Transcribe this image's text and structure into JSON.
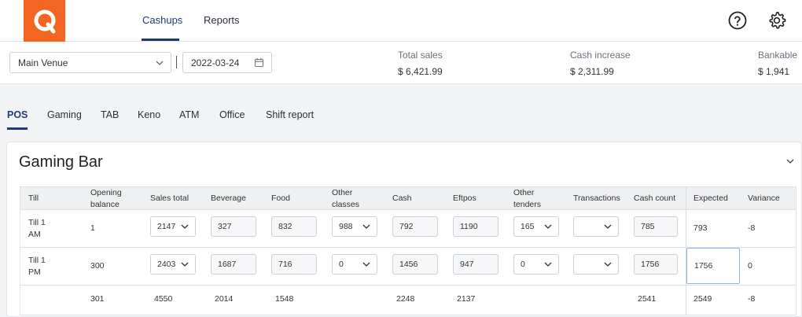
{
  "nav": {
    "logo_letter": "Q",
    "tabs": [
      "Cashups",
      "Reports"
    ]
  },
  "filters": {
    "venue": "Main Venue",
    "date": "2022-03-24"
  },
  "stats": [
    {
      "label": "Total sales",
      "value": "$ 6,421.99"
    },
    {
      "label": "Cash increase",
      "value": "$ 2,311.99"
    },
    {
      "label": "Bankable",
      "value": "$ 1,941"
    }
  ],
  "subtabs": [
    "POS",
    "Gaming",
    "TAB",
    "Keno",
    "ATM",
    "Office",
    "Shift report"
  ],
  "section": {
    "title": "Gaming Bar",
    "columns": [
      "Till",
      "Opening balance",
      "Sales total",
      "Beverage",
      "Food",
      "Other classes",
      "Cash",
      "Eftpos",
      "Other tenders",
      "Transactions",
      "Cash count",
      "Expected",
      "Variance"
    ],
    "rows": [
      {
        "till": "Till 1 AM",
        "opening": "1",
        "sales_total": "2147",
        "beverage": "327",
        "food": "832",
        "other_classes": "988",
        "cash": "792",
        "eftpos": "1190",
        "other_tenders": "165",
        "transactions": "",
        "cash_count": "785",
        "expected": "793",
        "variance": "-8"
      },
      {
        "till": "Till 1 PM",
        "opening": "300",
        "sales_total": "2403",
        "beverage": "1687",
        "food": "716",
        "other_classes": "0",
        "cash": "1456",
        "eftpos": "947",
        "other_tenders": "0",
        "transactions": "",
        "cash_count": "1756",
        "expected": "1756",
        "variance": "0"
      }
    ],
    "totals": {
      "opening": "301",
      "sales_total": "4550",
      "beverage": "2014",
      "food": "1548",
      "cash": "2248",
      "eftpos": "2137",
      "cash_count": "2541",
      "expected": "2549",
      "variance": "-8"
    }
  }
}
